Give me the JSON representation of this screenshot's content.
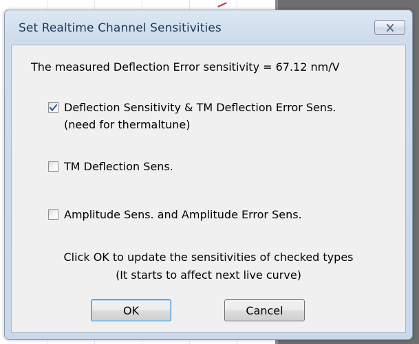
{
  "dialog": {
    "title": "Set Realtime Channel Sensitivities",
    "close_icon": "close-x-icon",
    "info_text": "The measured Deflection Error sensitivity = 67.12 nm/V",
    "options": [
      {
        "label": "Deflection Sensitivity & TM Deflection Error Sens.",
        "sublabel": "(need for thermaltune)",
        "checked": true
      },
      {
        "label": "TM Deflection Sens.",
        "checked": false
      },
      {
        "label": "Amplitude Sens. and Amplitude Error Sens.",
        "checked": false
      }
    ],
    "footer_line1": "Click OK to update the sensitivities of checked types",
    "footer_line2": "(It starts to affect next live curve)",
    "ok_label": "OK",
    "cancel_label": "Cancel"
  },
  "colors": {
    "title_text": "#1e395b",
    "checkmark": "#2f5da8",
    "background_panel": "#6e6e6e"
  }
}
